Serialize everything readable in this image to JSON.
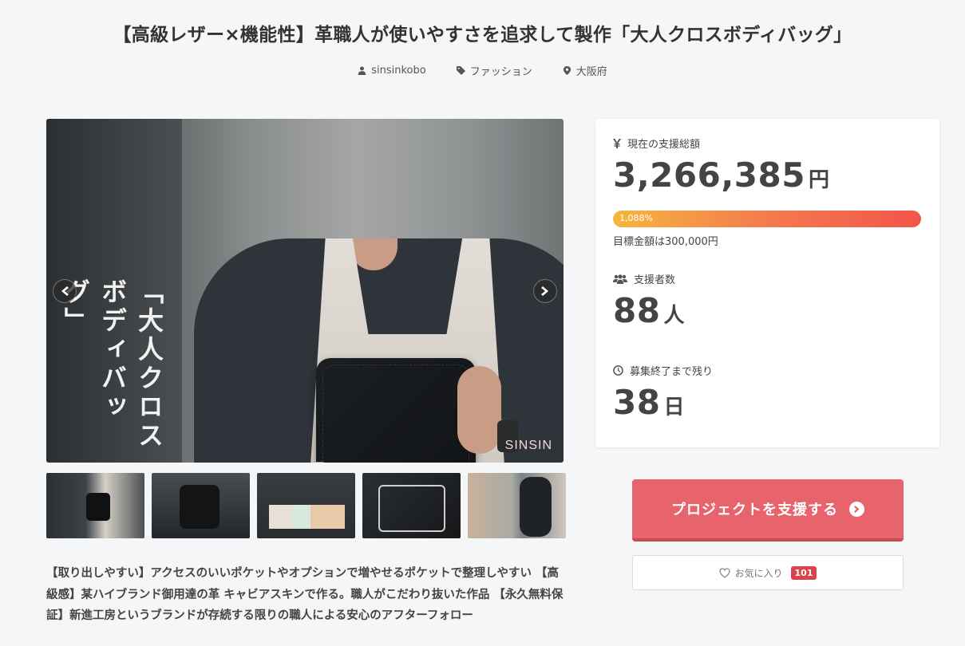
{
  "project": {
    "title": "【高級レザー×機能性】革職人が使いやすさを追求して製作「大人クロスボディバッグ」",
    "owner": "sinsinkobo",
    "category": "ファッション",
    "location": "大阪府"
  },
  "hero": {
    "overlay_text": "「大人クロスボディバッグ」",
    "brand": "SINSIN",
    "thumbnail_count": 5,
    "active_index": 0
  },
  "description": "【取り出しやすい】アクセスのいいポケットやオプションで増やせるポケットで整理しやすい 【高級感】某ハイブランド御用達の革 キャビアスキンで作る。職人がこだわり抜いた作品 【永久無料保証】新進工房というブランドが存続する限りの職人による安心のアフターフォロー",
  "stats": {
    "amount_label": "現在の支援総額",
    "amount": "3,266,385",
    "amount_unit": "円",
    "progress_text": "1,088%",
    "progress_fraction": 1.0,
    "goal_text": "目標金額は300,000円",
    "backers_label": "支援者数",
    "backers": "88",
    "backers_unit": "人",
    "remaining_label": "募集終了まで残り",
    "remaining": "38",
    "remaining_unit": "日"
  },
  "actions": {
    "support_label": "プロジェクトを支援する",
    "favorite_label": "お気に入り",
    "favorite_count": "101"
  },
  "colors": {
    "accent": "#e8646c",
    "badge": "#d9434b"
  }
}
